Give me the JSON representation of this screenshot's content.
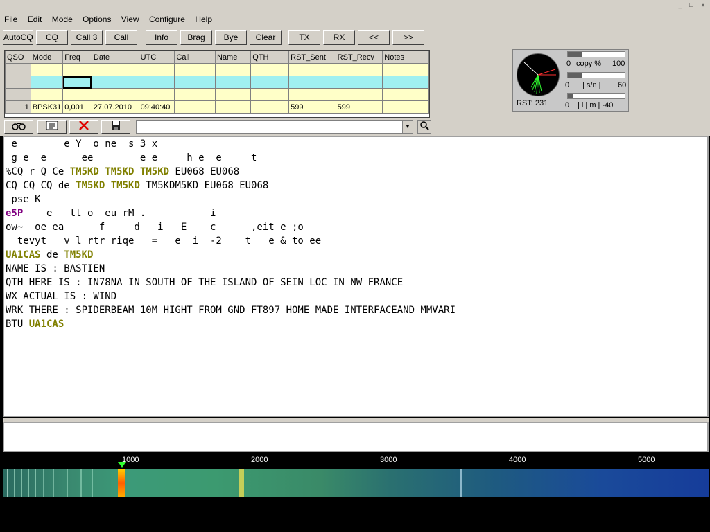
{
  "window": {
    "min": "_",
    "max": "□",
    "close": "x"
  },
  "menu": [
    "File",
    "Edit",
    "Mode",
    "Options",
    "View",
    "Configure",
    "Help"
  ],
  "toolbar": {
    "buttons": [
      "AutoCQ",
      "CQ",
      "Call 3",
      "Call",
      "Info",
      "Brag",
      "Bye",
      "Clear",
      "TX",
      "RX",
      "<<",
      ">>"
    ]
  },
  "log": {
    "headers": [
      "QSO",
      "Mode",
      "Freq",
      "Date",
      "UTC",
      "Call",
      "Name",
      "QTH",
      "RST_Sent",
      "RST_Recv",
      "Notes"
    ],
    "rows": [
      [
        "",
        "",
        "",
        "",
        "",
        "",
        "",
        "",
        "",
        "",
        ""
      ],
      [
        "",
        "",
        "",
        "",
        "",
        "",
        "",
        "",
        "",
        "",
        ""
      ],
      [
        "",
        "",
        "",
        "",
        "",
        "",
        "",
        "",
        "",
        "",
        ""
      ],
      [
        "1",
        "BPSK31",
        "0,001",
        "27.07.2010",
        "09:40:40",
        "",
        "",
        "",
        "599",
        "599",
        ""
      ]
    ]
  },
  "icons": {
    "find": "binoculars-icon",
    "edit": "form-icon",
    "delete": "red-x-icon",
    "save": "floppy-icon",
    "search": "magnifier-icon"
  },
  "search": {
    "value": ""
  },
  "meter": {
    "rst": "RST: 231",
    "copy": {
      "min": "0",
      "label": "copy %",
      "max": "100",
      "level": 0.25
    },
    "sn": {
      "min": "0",
      "label": "| s/n |",
      "max": "60",
      "level": 0.25
    },
    "imd": {
      "min": "0",
      "label": "| i | m | -40",
      "level": 0.1
    }
  },
  "receive": {
    "lines": [
      " e        e Y  o ne  s 3 x",
      " g e  e      ee        e e     h e  e     t",
      "%CQ r Q Ce |TM5KD| |TM5KD| |TM5KD| EU068 EU068",
      "CQ CQ CQ de |TM5KD| |TM5KD| TM5KDM5KD EU068 EU068",
      " pse K",
      "~e5P~    e   tt o  eu rM .           i",
      "ow~  oe ea      f     d   i   E    c      ,eit e ;o",
      "  tevyt   v l rtr riqe   =   e  i  -2    t   e & to ee",
      "|UA1CAS| de |TM5KD|",
      "NAME IS : BASTIEN",
      "QTH HERE IS : IN78NA IN SOUTH OF THE ISLAND OF SEIN LOC IN NW FRANCE",
      "WX ACTUAL IS : WIND",
      "WRK THERE : SPIDERBEAM 10M HIGHT FROM GND FT897 HOME MADE INTERFACEAND MMVARI",
      "BTU |UA1CAS|"
    ]
  },
  "waterfall": {
    "ticks": [
      "1000",
      "2000",
      "3000",
      "4000",
      "5000"
    ],
    "marker_hz": 1000
  },
  "colors": {
    "callsign": "#808000",
    "highlight": "#800080",
    "grid_yellow": "#ffffc8",
    "grid_cyan": "#a0f0f0"
  }
}
